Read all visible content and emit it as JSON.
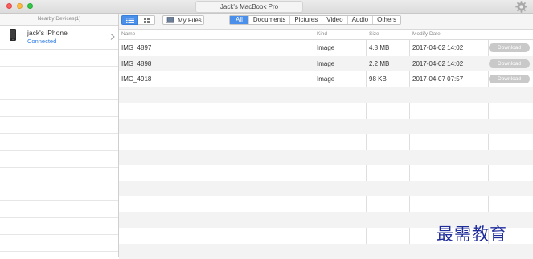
{
  "window": {
    "title": "Jack's MacBook Pro",
    "colors": {
      "accent": "#4a8fea",
      "status_connected": "#2f7de1",
      "watermark": "#1f2d9b"
    }
  },
  "sidebar": {
    "header": "Nearby Devices(1)",
    "device": {
      "name": "jack's iPhone",
      "status": "Connected",
      "icon": "phone-icon"
    }
  },
  "toolbar": {
    "view_modes": [
      "list-view-icon",
      "grid-view-icon"
    ],
    "my_files_label": "My Files",
    "filters": [
      "All",
      "Documents",
      "Pictures",
      "Video",
      "Audio",
      "Others"
    ],
    "active_filter": "All"
  },
  "table": {
    "columns": [
      "Name",
      "Kind",
      "Size",
      "Modify Date"
    ],
    "rows": [
      {
        "name": "IMG_4897",
        "kind": "Image",
        "size": "4.8 MB",
        "date": "2017-04-02 14:02",
        "action": "Download"
      },
      {
        "name": "IMG_4898",
        "kind": "Image",
        "size": "2.2 MB",
        "date": "2017-04-02 14:02",
        "action": "Download"
      },
      {
        "name": "IMG_4918",
        "kind": "Image",
        "size": "98 KB",
        "date": "2017-04-07 07:57",
        "action": "Download"
      }
    ]
  },
  "watermark": "最需教育"
}
